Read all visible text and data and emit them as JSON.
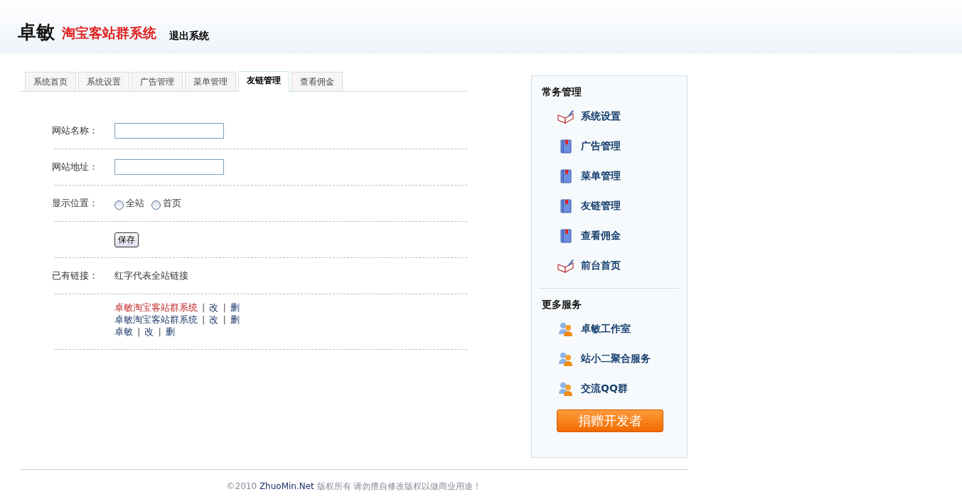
{
  "header": {
    "logo_main": "卓敏",
    "logo_sub": "淘宝客站群系统",
    "logout": "退出系统"
  },
  "tabs": [
    {
      "label": "系统首页",
      "selected": false
    },
    {
      "label": "系统设置",
      "selected": false
    },
    {
      "label": "广告管理",
      "selected": false
    },
    {
      "label": "菜单管理",
      "selected": false
    },
    {
      "label": "友链管理",
      "selected": true
    },
    {
      "label": "查看佣金",
      "selected": false
    }
  ],
  "form": [
    {
      "kind": "text",
      "label": "网站名称："
    },
    {
      "kind": "text",
      "label": "网站地址："
    },
    {
      "kind": "radio",
      "label": "显示位置：",
      "options": [
        {
          "label": "全站",
          "selected": false
        },
        {
          "label": "首页",
          "selected": false
        }
      ]
    },
    {
      "kind": "button",
      "text": "保存"
    },
    {
      "kind": "note",
      "label": "已有链接：",
      "text": "红字代表全站链接"
    }
  ],
  "links": [
    {
      "name": "卓敏淘宝客站群系统",
      "site_wide": true,
      "actions": [
        {
          "sep": "|",
          "label": "改"
        },
        {
          "sep": "|",
          "label": "删"
        }
      ]
    },
    {
      "name": "卓敏淘宝客站群系统",
      "site_wide": false,
      "actions": [
        {
          "sep": "|",
          "label": "改"
        },
        {
          "sep": "|",
          "label": "删"
        }
      ]
    },
    {
      "name": "卓敏",
      "site_wide": false,
      "actions": [
        {
          "sep": "|",
          "label": "改"
        },
        {
          "sep": "|",
          "label": "删"
        }
      ]
    }
  ],
  "sidebar": {
    "sections": [
      {
        "title": "常务管理",
        "items": [
          {
            "label": "系统设置",
            "kind": "book"
          },
          {
            "label": "广告管理",
            "kind": "bookmark"
          },
          {
            "label": "菜单管理",
            "kind": "bookmark"
          },
          {
            "label": "友链管理",
            "kind": "bookmark"
          },
          {
            "label": "查看佣金",
            "kind": "bookmark"
          },
          {
            "label": "前台首页",
            "kind": "book"
          }
        ]
      },
      {
        "title": "更多服务",
        "items": [
          {
            "label": "卓敏工作室",
            "kind": "users"
          },
          {
            "label": "站小二聚合服务",
            "kind": "users"
          },
          {
            "label": "交流QQ群",
            "kind": "users"
          }
        ]
      }
    ],
    "donate": "捐赠开发者"
  },
  "footer": {
    "year": "©2010",
    "site": "ZhuoMin.Net",
    "notice": "版权所有  请勿擅自修改版权以做商业用途！"
  }
}
